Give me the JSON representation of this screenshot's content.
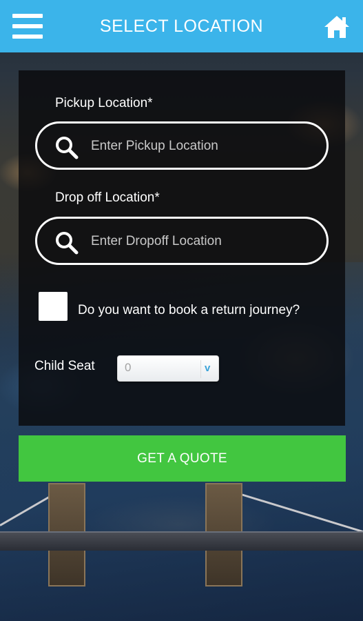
{
  "header": {
    "title": "SELECT LOCATION",
    "menu_icon": "hamburger-menu-icon",
    "home_icon": "home-icon",
    "background_color": "#3bb4ea"
  },
  "form": {
    "pickup": {
      "label": "Pickup Location*",
      "placeholder": "Enter Pickup Location",
      "value": "",
      "icon": "search-icon"
    },
    "dropoff": {
      "label": "Drop off Location*",
      "placeholder": "Enter Dropoff Location",
      "value": "",
      "icon": "search-icon"
    },
    "return_journey": {
      "label": "Do you want to book a return journey?",
      "checked": false
    },
    "child_seat": {
      "label": "Child Seat",
      "selected": "0",
      "dropdown_icon": "chevron-down-icon"
    }
  },
  "actions": {
    "quote_label": "GET A QUOTE",
    "quote_color": "#42c640"
  }
}
